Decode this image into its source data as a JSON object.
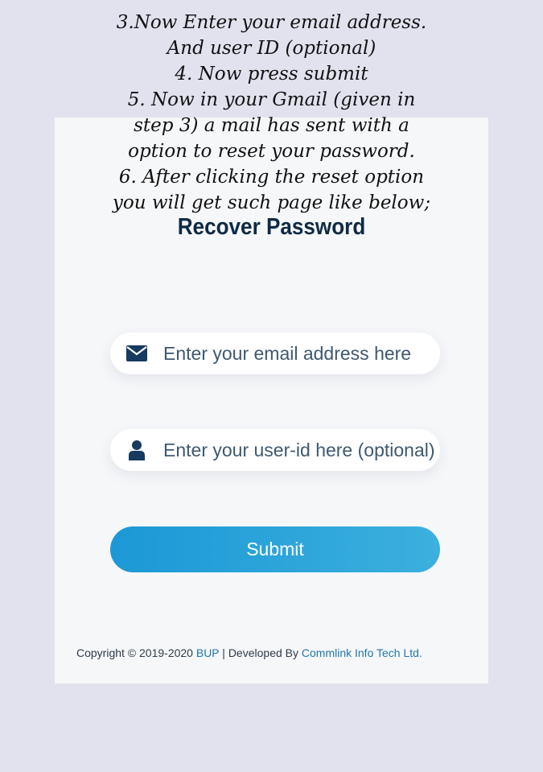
{
  "instructions": [
    "3.Now Enter your email address.",
    "And user ID (optional)",
    "4. Now press submit",
    "5. Now in your Gmail (given in",
    "step 3) a mail has sent with a",
    "option to reset your password.",
    "6. After clicking the reset option",
    "you will get such page like below;"
  ],
  "page": {
    "title": "Recover Password"
  },
  "form": {
    "email_placeholder": "Enter your email address here",
    "email_icon": "envelope-icon",
    "userid_placeholder": "Enter your user-id here (optional)",
    "userid_icon": "user-icon",
    "submit_label": "Submit"
  },
  "footer": {
    "copyright_prefix": "Copyright © 2019-2020 ",
    "org_link": "BUP",
    "separator": " | Developed By ",
    "developer_link": "Commlink Info Tech Ltd."
  },
  "colors": {
    "background": "#e1e2ee",
    "card": "#f6f7f9",
    "title": "#0e2a44",
    "icon": "#163a60",
    "button_start": "#1b98d6",
    "button_end": "#3cb0de",
    "link": "#2277aa"
  }
}
